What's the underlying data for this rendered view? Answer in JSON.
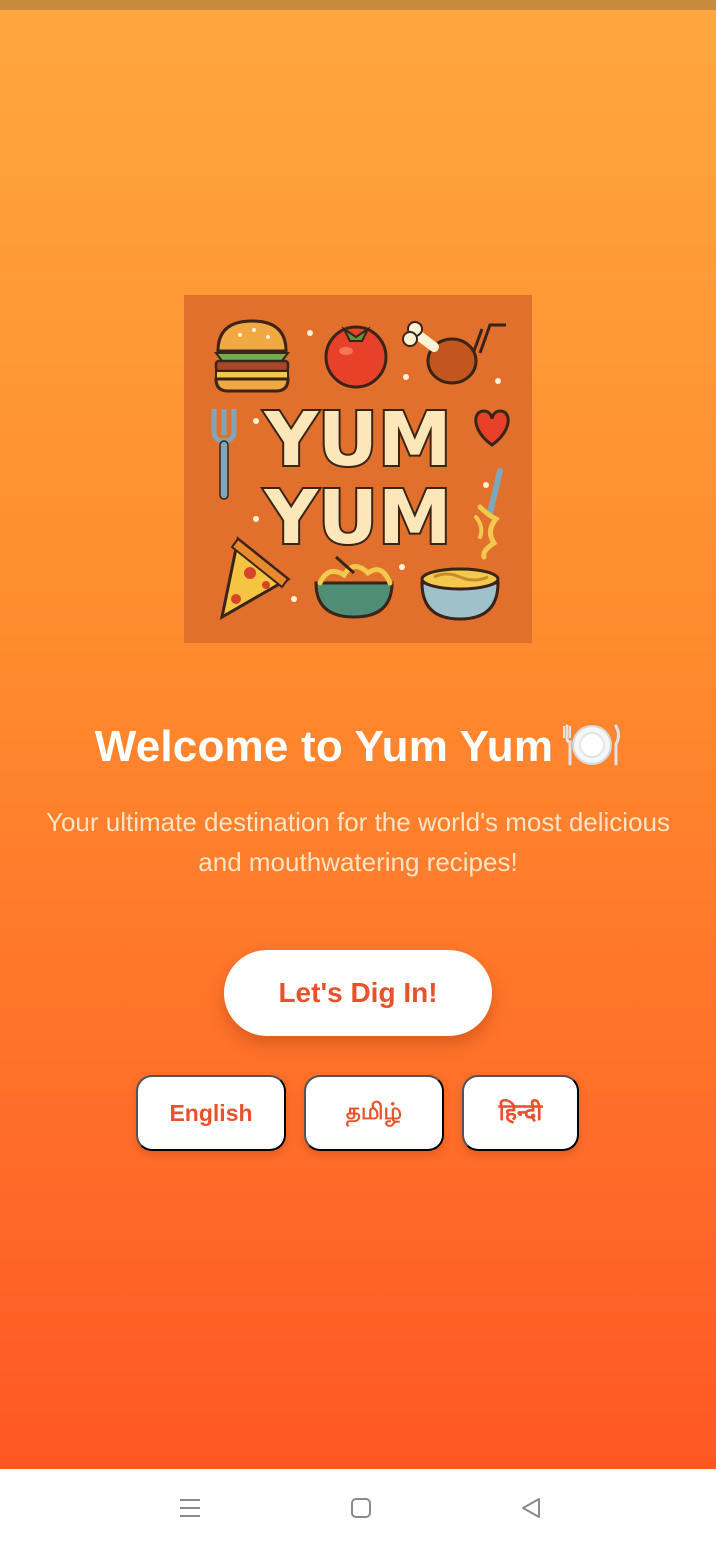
{
  "colors": {
    "accent": "#e8512a",
    "gradient_top": "#ffa73e",
    "gradient_bottom": "#ff5722",
    "logo_bg": "#e0702c"
  },
  "logo": {
    "line1": "YUM",
    "line2": "YUM",
    "icons": [
      "burger-icon",
      "tomato-icon",
      "chicken-leg-icon",
      "fork-icon",
      "heart-icon",
      "noodle-fork-icon",
      "pizza-slice-icon",
      "noodle-bowl-icon",
      "soup-bowl-icon"
    ]
  },
  "welcome": {
    "title": "Welcome to Yum Yum",
    "title_icon": "plate-cutlery-icon",
    "subtitle": "Your ultimate destination for the world's most delicious and mouthwatering recipes!"
  },
  "cta": {
    "label": "Let's Dig In!"
  },
  "languages": [
    {
      "label": "English"
    },
    {
      "label": "தமிழ்"
    },
    {
      "label": "हिन्दी"
    }
  ],
  "navbar": {
    "icons": [
      "menu-icon",
      "home-square-icon",
      "back-triangle-icon"
    ]
  }
}
